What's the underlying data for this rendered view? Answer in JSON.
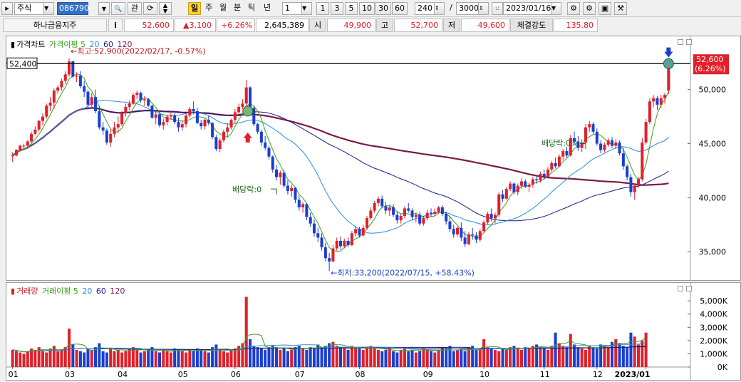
{
  "toolbar": {
    "type_label": "주식",
    "code_value": "086790",
    "btn_search": "🔍",
    "btn_kwan": "관",
    "btn_day": "일",
    "btn_week": "주",
    "btn_month": "월",
    "btn_minute": "분",
    "btn_tick": "틱",
    "btn_year": "년",
    "period_select": "1",
    "p1": "1",
    "p3": "3",
    "p5": "5",
    "p10": "10",
    "p30": "30",
    "p60": "60",
    "count_value": "240",
    "slash": "/",
    "total_value": "3000",
    "date_value": "2023/01/16"
  },
  "info": {
    "stock_name": "하나금융지주",
    "info_btn": "i",
    "price": "52,600",
    "change": "▲3,100",
    "change_pct": "+6.26%",
    "volume": "2,645,389",
    "open_label": "시",
    "open": "49,900",
    "high_label": "고",
    "high": "52,700",
    "low_label": "저",
    "low": "49,600",
    "strength_label": "체결강도",
    "strength": "135.80"
  },
  "price_panel": {
    "legend_main": "가격차트",
    "legend_ma5": "가격이평 5",
    "legend_ma20": "20",
    "legend_ma60": "60",
    "legend_ma120": "120",
    "hline_label": "52,400",
    "high_annotation": "←최고:52,900(2022/02/17, -0.57%)",
    "low_annotation": "←최저:33,200(2022/07/15, +58.43%)",
    "dividend1": "배당락:0",
    "dividend2": "배당락:0%",
    "last_price": "52,600",
    "last_pct": "(6.26%)",
    "y_labels": [
      "50,000",
      "45,000",
      "40,000",
      "35,000"
    ]
  },
  "volume_panel": {
    "legend_main": "거래량",
    "legend_ma5": "거래이평 5",
    "legend_ma20": "20",
    "legend_ma60": "60",
    "legend_ma120": "120",
    "y_labels": [
      "5,000K",
      "4,000K",
      "3,000K",
      "2,000K",
      "1,000K",
      "0K"
    ],
    "x_labels": [
      "01",
      "03",
      "04",
      "05",
      "06",
      "07",
      "08",
      "09",
      "10",
      "11",
      "12",
      "2023/01"
    ]
  },
  "chart_data": {
    "type": "candlestick",
    "price_series": [
      [
        43900,
        44200,
        43300,
        43900
      ],
      [
        43900,
        44500,
        43800,
        44400
      ],
      [
        44400,
        44900,
        44300,
        44800
      ],
      [
        44800,
        45000,
        44500,
        44800
      ],
      [
        44800,
        45300,
        44600,
        45200
      ],
      [
        45200,
        46100,
        45000,
        45900
      ],
      [
        45900,
        46600,
        45800,
        46300
      ],
      [
        46300,
        47200,
        46100,
        47100
      ],
      [
        47100,
        47800,
        46700,
        47500
      ],
      [
        47500,
        48700,
        47300,
        48500
      ],
      [
        48500,
        49300,
        48000,
        48800
      ],
      [
        48800,
        50100,
        48200,
        49900
      ],
      [
        49900,
        50400,
        49600,
        50200
      ],
      [
        50200,
        51000,
        49900,
        50800
      ],
      [
        50800,
        51700,
        50500,
        51400
      ],
      [
        51400,
        52900,
        51200,
        52600
      ],
      [
        52600,
        52700,
        51100,
        51200
      ],
      [
        51200,
        51600,
        50700,
        51300
      ],
      [
        51300,
        51700,
        50100,
        50300
      ],
      [
        50300,
        50800,
        49300,
        49800
      ],
      [
        49800,
        50000,
        48200,
        48600
      ],
      [
        48600,
        49700,
        48400,
        49300
      ],
      [
        49300,
        50000,
        47800,
        48000
      ],
      [
        48000,
        48500,
        46300,
        46500
      ],
      [
        46500,
        47000,
        45800,
        46200
      ],
      [
        46200,
        46400,
        44900,
        45100
      ],
      [
        45100,
        46300,
        44700,
        45900
      ],
      [
        45900,
        47000,
        45600,
        46500
      ],
      [
        46500,
        47500,
        46000,
        46800
      ],
      [
        46800,
        48000,
        46600,
        47800
      ],
      [
        47800,
        48700,
        47500,
        48400
      ],
      [
        48400,
        49000,
        48100,
        48700
      ],
      [
        48700,
        49700,
        48600,
        49500
      ],
      [
        49500,
        49900,
        49100,
        49700
      ],
      [
        49700,
        49800,
        48800,
        49000
      ],
      [
        49000,
        49400,
        48500,
        49100
      ],
      [
        49100,
        49200,
        48400,
        48500
      ],
      [
        48500,
        48600,
        47300,
        47400
      ],
      [
        47400,
        47900,
        46800,
        47700
      ],
      [
        47700,
        48000,
        46500,
        46700
      ],
      [
        46700,
        47300,
        46300,
        47000
      ],
      [
        47000,
        47700,
        46700,
        47500
      ],
      [
        47500,
        48000,
        47200,
        47600
      ],
      [
        47600,
        47800,
        46800,
        47000
      ],
      [
        47000,
        47400,
        46100,
        46500
      ],
      [
        46500,
        47100,
        46200,
        46800
      ],
      [
        46800,
        47800,
        46500,
        47600
      ],
      [
        47600,
        48400,
        47400,
        48200
      ],
      [
        48200,
        48900,
        47700,
        48000
      ],
      [
        48000,
        48300,
        46800,
        46900
      ],
      [
        46900,
        47200,
        46300,
        46600
      ],
      [
        46600,
        47300,
        46300,
        47200
      ],
      [
        47200,
        47600,
        46700,
        46900
      ],
      [
        46900,
        47000,
        45400,
        45600
      ],
      [
        45600,
        45800,
        44300,
        44500
      ],
      [
        44500,
        45500,
        44200,
        45300
      ],
      [
        45300,
        46300,
        45100,
        46100
      ],
      [
        46100,
        46900,
        45600,
        46500
      ],
      [
        46500,
        47300,
        46300,
        47200
      ],
      [
        47200,
        48200,
        46900,
        47900
      ],
      [
        47900,
        48700,
        47700,
        48400
      ],
      [
        48400,
        49100,
        48200,
        48700
      ],
      [
        48700,
        50900,
        48500,
        50200
      ],
      [
        50200,
        50300,
        47900,
        48300
      ],
      [
        48300,
        48500,
        46600,
        46800
      ],
      [
        46800,
        46900,
        45900,
        46100
      ],
      [
        46100,
        46300,
        44800,
        45100
      ],
      [
        45100,
        45700,
        44400,
        44600
      ],
      [
        44600,
        44800,
        43500,
        43800
      ],
      [
        43800,
        43900,
        42300,
        42600
      ],
      [
        42600,
        43000,
        41600,
        41900
      ],
      [
        41900,
        42500,
        41200,
        42300
      ],
      [
        42300,
        42500,
        40900,
        41100
      ],
      [
        41100,
        41600,
        40300,
        40600
      ],
      [
        40600,
        41200,
        40100,
        40900
      ],
      [
        40900,
        41000,
        39500,
        39800
      ],
      [
        39800,
        40200,
        38800,
        39100
      ],
      [
        39100,
        39600,
        38600,
        39400
      ],
      [
        39400,
        39500,
        37900,
        38200
      ],
      [
        38200,
        38600,
        37300,
        37600
      ],
      [
        37600,
        38000,
        36400,
        36700
      ],
      [
        36700,
        37200,
        35900,
        36300
      ],
      [
        36300,
        36700,
        35100,
        35400
      ],
      [
        35400,
        35800,
        34100,
        34400
      ],
      [
        34400,
        34900,
        33200,
        34100
      ],
      [
        34100,
        35600,
        34000,
        35300
      ],
      [
        35300,
        36300,
        35100,
        36000
      ],
      [
        36000,
        36400,
        35200,
        35500
      ],
      [
        35500,
        36200,
        35300,
        36000
      ],
      [
        36000,
        36300,
        35400,
        35600
      ],
      [
        35600,
        36900,
        35500,
        36700
      ],
      [
        36700,
        37400,
        36400,
        37100
      ],
      [
        37100,
        37300,
        36300,
        36500
      ],
      [
        36500,
        37500,
        36400,
        37200
      ],
      [
        37200,
        38300,
        37000,
        38100
      ],
      [
        38100,
        39100,
        37900,
        38800
      ],
      [
        38800,
        39700,
        38600,
        39500
      ],
      [
        39500,
        40100,
        39200,
        39900
      ],
      [
        39900,
        40200,
        39000,
        39200
      ],
      [
        39200,
        39600,
        38500,
        38800
      ],
      [
        38800,
        39300,
        38300,
        39100
      ],
      [
        39100,
        39400,
        38200,
        38400
      ],
      [
        38400,
        38700,
        37600,
        37900
      ],
      [
        37900,
        38500,
        37600,
        38300
      ],
      [
        38300,
        39200,
        38100,
        39000
      ],
      [
        39000,
        39500,
        38600,
        38800
      ],
      [
        38800,
        39000,
        37900,
        38200
      ],
      [
        38200,
        38600,
        37700,
        38400
      ],
      [
        38400,
        38700,
        37400,
        37600
      ],
      [
        37600,
        38300,
        37400,
        38100
      ],
      [
        38100,
        38900,
        37900,
        38600
      ],
      [
        38600,
        39000,
        38200,
        38500
      ],
      [
        38500,
        39000,
        38300,
        38700
      ],
      [
        38700,
        39200,
        38500,
        39100
      ],
      [
        39100,
        39300,
        38300,
        38500
      ],
      [
        38500,
        38700,
        37500,
        37800
      ],
      [
        37800,
        38300,
        36800,
        37100
      ],
      [
        37100,
        37500,
        36300,
        36600
      ],
      [
        36600,
        37300,
        36400,
        37200
      ],
      [
        37200,
        37700,
        36000,
        36300
      ],
      [
        36300,
        36900,
        35400,
        35700
      ],
      [
        35700,
        36800,
        35600,
        36600
      ],
      [
        36600,
        37200,
        36100,
        36500
      ],
      [
        36500,
        36800,
        35800,
        36100
      ],
      [
        36100,
        37100,
        35900,
        36900
      ],
      [
        36900,
        37900,
        36800,
        37700
      ],
      [
        37700,
        38700,
        37500,
        38500
      ],
      [
        38500,
        39000,
        37800,
        38100
      ],
      [
        38100,
        38600,
        37600,
        38400
      ],
      [
        38400,
        40500,
        38200,
        40300
      ],
      [
        40300,
        40700,
        39600,
        39900
      ],
      [
        39900,
        41000,
        39800,
        40800
      ],
      [
        40800,
        41500,
        40600,
        41300
      ],
      [
        41300,
        41400,
        40300,
        40500
      ],
      [
        40500,
        41300,
        40200,
        41100
      ],
      [
        41100,
        41800,
        40800,
        41500
      ],
      [
        41500,
        41700,
        40900,
        41000
      ],
      [
        41000,
        41400,
        40500,
        41200
      ],
      [
        41200,
        41900,
        40900,
        41700
      ],
      [
        41700,
        42100,
        41300,
        41600
      ],
      [
        41600,
        42400,
        41400,
        42200
      ],
      [
        42200,
        42600,
        41700,
        41900
      ],
      [
        41900,
        42800,
        41800,
        42600
      ],
      [
        42600,
        43400,
        42400,
        43200
      ],
      [
        43200,
        43700,
        42700,
        42900
      ],
      [
        42900,
        44000,
        42800,
        43800
      ],
      [
        43800,
        44500,
        43500,
        44300
      ],
      [
        44300,
        44700,
        43700,
        43900
      ],
      [
        43900,
        45800,
        43800,
        45500
      ],
      [
        45500,
        46100,
        44900,
        45200
      ],
      [
        45200,
        45700,
        44300,
        44600
      ],
      [
        44600,
        45400,
        44200,
        45100
      ],
      [
        45100,
        46800,
        44900,
        46500
      ],
      [
        46500,
        47100,
        46100,
        46800
      ],
      [
        46800,
        47000,
        45900,
        46100
      ],
      [
        46100,
        46400,
        44800,
        45000
      ],
      [
        45000,
        45300,
        44100,
        44400
      ],
      [
        44400,
        45100,
        44200,
        44900
      ],
      [
        44900,
        45500,
        44700,
        45300
      ],
      [
        45300,
        45600,
        44600,
        44800
      ],
      [
        44800,
        45400,
        44500,
        45100
      ],
      [
        45100,
        45300,
        43900,
        44100
      ],
      [
        44100,
        44600,
        42600,
        42900
      ],
      [
        42900,
        43100,
        41600,
        41900
      ],
      [
        41900,
        42200,
        40100,
        40500
      ],
      [
        40500,
        41300,
        39800,
        41100
      ],
      [
        41100,
        41900,
        40900,
        41700
      ],
      [
        41700,
        45500,
        41500,
        45100
      ],
      [
        45100,
        47300,
        44900,
        47000
      ],
      [
        47000,
        49200,
        46800,
        48900
      ],
      [
        48900,
        49500,
        48400,
        49200
      ],
      [
        49200,
        49400,
        48100,
        48600
      ],
      [
        48600,
        49500,
        48300,
        49200
      ],
      [
        49200,
        49700,
        48700,
        49500
      ],
      [
        49900,
        52700,
        49600,
        52600
      ]
    ],
    "volume_series_k": [
      1300,
      1200,
      1100,
      1000,
      1200,
      1400,
      1300,
      1500,
      1200,
      1100,
      1400,
      1600,
      1200,
      1300,
      1500,
      2900,
      1700,
      1300,
      1200,
      1100,
      1400,
      1300,
      1500,
      1800,
      1200,
      1100,
      1400,
      1200,
      1300,
      1100,
      1200,
      1400,
      1500,
      1300,
      1100,
      1200,
      1300,
      1500,
      1200,
      1100,
      1300,
      1200,
      1100,
      1400,
      1300,
      1200,
      1100,
      1300,
      1200,
      1400,
      1300,
      1200,
      1100,
      1500,
      1700,
      1300,
      1200,
      1100,
      1300,
      1400,
      1600,
      1800,
      5300,
      2100,
      1600,
      1500,
      1400,
      1300,
      1500,
      1600,
      1500,
      1300,
      1400,
      1200,
      1300,
      1500,
      1600,
      1400,
      1300,
      1500,
      1400,
      1700,
      1500,
      1600,
      1800,
      1900,
      1600,
      1500,
      1400,
      1300,
      1600,
      1500,
      1400,
      1300,
      1500,
      1600,
      1400,
      1300,
      1200,
      1300,
      1400,
      1200,
      1100,
      1300,
      1400,
      1200,
      1300,
      1100,
      1200,
      1400,
      1300,
      1200,
      1100,
      1300,
      1500,
      1400,
      1600,
      1200,
      1300,
      1400,
      1200,
      1500,
      1600,
      1300,
      1400,
      2100,
      1500,
      1400,
      1300,
      1200,
      1400,
      1300,
      1500,
      1600,
      1400,
      1300,
      1500,
      1400,
      1600,
      1700,
      1500,
      1400,
      1300,
      1600,
      2600,
      1800,
      1600,
      1500,
      2500,
      1700,
      1500,
      1400,
      1300,
      1600,
      1500,
      1400,
      1700,
      1600,
      1500,
      1900,
      2100,
      1800,
      1600,
      1500,
      2600,
      2300,
      1700,
      2000,
      2600
    ],
    "dividend_markers": [
      {
        "index": 70
      },
      {
        "index": 152
      }
    ],
    "y_range": [
      32500,
      54000
    ],
    "volume_range_k": [
      0,
      5600
    ]
  }
}
